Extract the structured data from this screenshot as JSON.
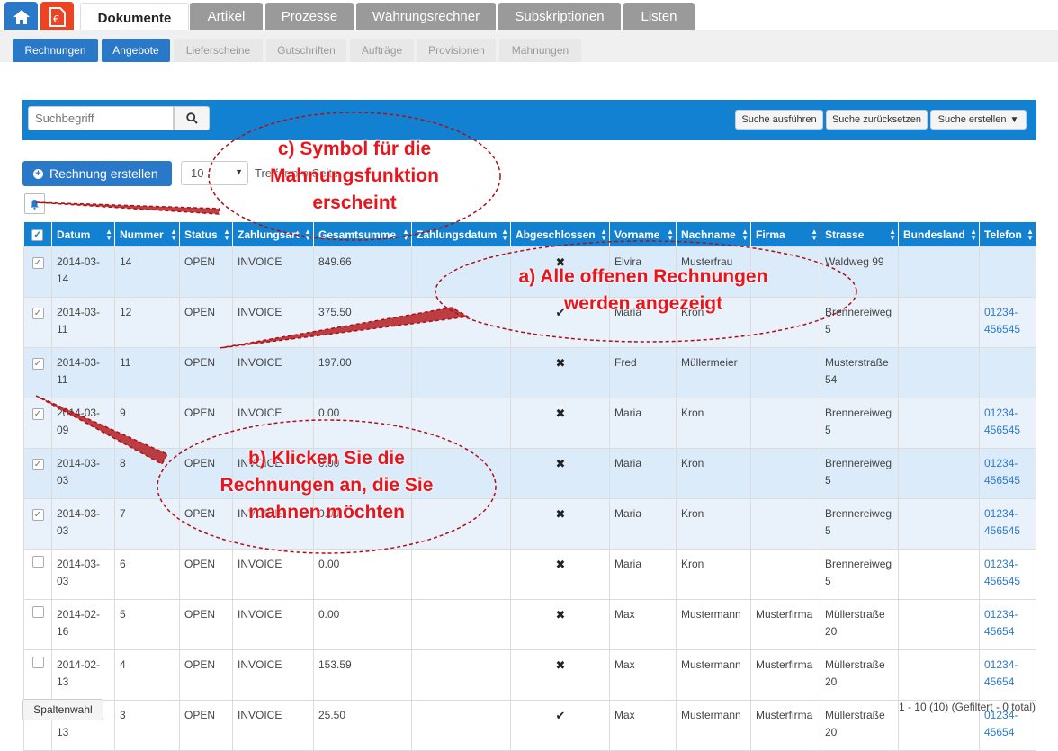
{
  "top_tabs": [
    "Dokumente",
    "Artikel",
    "Prozesse",
    "Währungsrechner",
    "Subskriptionen",
    "Listen"
  ],
  "sub_tabs": [
    "Rechnungen",
    "Angebote",
    "Lieferscheine",
    "Gutschriften",
    "Aufträge",
    "Provisionen",
    "Mahnungen"
  ],
  "search": {
    "placeholder": "Suchbegriff",
    "run_label": "Suche ausführen",
    "reset_label": "Suche zurücksetzen",
    "create_label": "Suche erstellen"
  },
  "toolbar": {
    "create_label": "Rechnung erstellen",
    "page_size": "10",
    "per_page_label": "Treffer pro Seite"
  },
  "table": {
    "columns": [
      "Datum",
      "Nummer",
      "Status",
      "Zahlungsart",
      "Gesamtsumme",
      "Zahlungsdatum",
      "Abgeschlossen",
      "Vorname",
      "Nachname",
      "Firma",
      "Strasse",
      "Bundesland",
      "Telefon"
    ],
    "rows": [
      {
        "checked": true,
        "datum": "2014-03-14",
        "nummer": "14",
        "status": "OPEN",
        "zahlungsart": "INVOICE",
        "summe": "849.66",
        "zahlungsdatum": "",
        "abgeschlossen": "✖",
        "vorname": "Elvira",
        "nachname": "Musterfrau",
        "firma": "",
        "strasse": "Waldweg 99",
        "bundesland": "",
        "telefon": ""
      },
      {
        "checked": true,
        "datum": "2014-03-11",
        "nummer": "12",
        "status": "OPEN",
        "zahlungsart": "INVOICE",
        "summe": "375.50",
        "zahlungsdatum": "",
        "abgeschlossen": "✔",
        "vorname": "Maria",
        "nachname": "Kron",
        "firma": "",
        "strasse": "Brennereiweg 5",
        "bundesland": "",
        "telefon": "01234-456545"
      },
      {
        "checked": true,
        "datum": "2014-03-11",
        "nummer": "11",
        "status": "OPEN",
        "zahlungsart": "INVOICE",
        "summe": "197.00",
        "zahlungsdatum": "",
        "abgeschlossen": "✖",
        "vorname": "Fred",
        "nachname": "Müllermeier",
        "firma": "",
        "strasse": "Musterstraße 54",
        "bundesland": "",
        "telefon": ""
      },
      {
        "checked": true,
        "datum": "2014-03-09",
        "nummer": "9",
        "status": "OPEN",
        "zahlungsart": "INVOICE",
        "summe": "0.00",
        "zahlungsdatum": "",
        "abgeschlossen": "✖",
        "vorname": "Maria",
        "nachname": "Kron",
        "firma": "",
        "strasse": "Brennereiweg 5",
        "bundesland": "",
        "telefon": "01234-456545"
      },
      {
        "checked": true,
        "datum": "2014-03-03",
        "nummer": "8",
        "status": "OPEN",
        "zahlungsart": "INVOICE",
        "summe": "0.00",
        "zahlungsdatum": "",
        "abgeschlossen": "✖",
        "vorname": "Maria",
        "nachname": "Kron",
        "firma": "",
        "strasse": "Brennereiweg 5",
        "bundesland": "",
        "telefon": "01234-456545"
      },
      {
        "checked": true,
        "datum": "2014-03-03",
        "nummer": "7",
        "status": "OPEN",
        "zahlungsart": "INVOICE",
        "summe": "0.00",
        "zahlungsdatum": "",
        "abgeschlossen": "✖",
        "vorname": "Maria",
        "nachname": "Kron",
        "firma": "",
        "strasse": "Brennereiweg 5",
        "bundesland": "",
        "telefon": "01234-456545"
      },
      {
        "checked": false,
        "datum": "2014-03-03",
        "nummer": "6",
        "status": "OPEN",
        "zahlungsart": "INVOICE",
        "summe": "0.00",
        "zahlungsdatum": "",
        "abgeschlossen": "✖",
        "vorname": "Maria",
        "nachname": "Kron",
        "firma": "",
        "strasse": "Brennereiweg 5",
        "bundesland": "",
        "telefon": "01234-456545"
      },
      {
        "checked": false,
        "datum": "2014-02-16",
        "nummer": "5",
        "status": "OPEN",
        "zahlungsart": "INVOICE",
        "summe": "0.00",
        "zahlungsdatum": "",
        "abgeschlossen": "✖",
        "vorname": "Max",
        "nachname": "Mustermann",
        "firma": "Musterfirma",
        "strasse": "Müllerstraße 20",
        "bundesland": "",
        "telefon": "01234-45654"
      },
      {
        "checked": false,
        "datum": "2014-02-13",
        "nummer": "4",
        "status": "OPEN",
        "zahlungsart": "INVOICE",
        "summe": "153.59",
        "zahlungsdatum": "",
        "abgeschlossen": "✖",
        "vorname": "Max",
        "nachname": "Mustermann",
        "firma": "Musterfirma",
        "strasse": "Müllerstraße 20",
        "bundesland": "",
        "telefon": "01234-45654"
      },
      {
        "checked": false,
        "datum": "2014-02-13",
        "nummer": "3",
        "status": "OPEN",
        "zahlungsart": "INVOICE",
        "summe": "25.50",
        "zahlungsdatum": "",
        "abgeschlossen": "✔",
        "vorname": "Max",
        "nachname": "Mustermann",
        "firma": "Musterfirma",
        "strasse": "Müllerstraße 20",
        "bundesland": "",
        "telefon": "01234-45654"
      }
    ]
  },
  "footer": {
    "columns_button": "Spaltenwahl",
    "page_info": "1 - 10 (10) (Gefiltert - 0 total)"
  },
  "annotations": {
    "c": "c) Symbol für die Mahnungsfunktion erscheint",
    "a": "a) Alle offenen Rechnungen werden angezeigt",
    "b": "b) Klicken Sie die Rechnungen an, die Sie mahnen möchten"
  },
  "colors": {
    "accent": "#1281d2",
    "brand_orange": "#ee4322",
    "annotation_red": "#e8151c"
  }
}
